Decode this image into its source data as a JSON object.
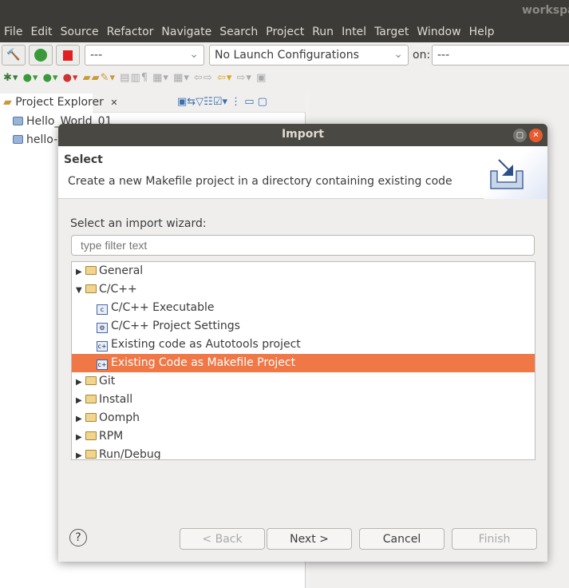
{
  "window": {
    "title": "workspa"
  },
  "menu": [
    "File",
    "Edit",
    "Source",
    "Refactor",
    "Navigate",
    "Search",
    "Project",
    "Run",
    "Intel",
    "Target",
    "Window",
    "Help"
  ],
  "toolbar": {
    "mode_combo": "---",
    "launch_combo": "No Launch Configurations",
    "on_label": "on:",
    "target_combo": "---"
  },
  "project_explorer": {
    "title": "Project Explorer",
    "items": [
      "Hello_World_01",
      "hello-w"
    ]
  },
  "dialog": {
    "title": "Import",
    "header_title": "Select",
    "header_desc": "Create a new Makefile project in a directory containing existing code",
    "wizard_label": "Select an import wizard:",
    "filter_placeholder": "type filter text",
    "tree": [
      {
        "label": "General",
        "level": 0,
        "expanded": false
      },
      {
        "label": "C/C++",
        "level": 0,
        "expanded": true
      },
      {
        "label": "C/C++ Executable",
        "level": 1
      },
      {
        "label": "C/C++ Project Settings",
        "level": 1
      },
      {
        "label": "Existing code as Autotools project",
        "level": 1
      },
      {
        "label": "Existing Code as Makefile Project",
        "level": 1,
        "selected": true
      },
      {
        "label": "Git",
        "level": 0,
        "expanded": false
      },
      {
        "label": "Install",
        "level": 0,
        "expanded": false
      },
      {
        "label": "Oomph",
        "level": 0,
        "expanded": false
      },
      {
        "label": "RPM",
        "level": 0,
        "expanded": false
      },
      {
        "label": "Run/Debug",
        "level": 0,
        "expanded": false
      }
    ],
    "buttons": {
      "help": "?",
      "back": "< Back",
      "next": "Next >",
      "cancel": "Cancel",
      "finish": "Finish"
    },
    "selection_color": "#f07746"
  }
}
